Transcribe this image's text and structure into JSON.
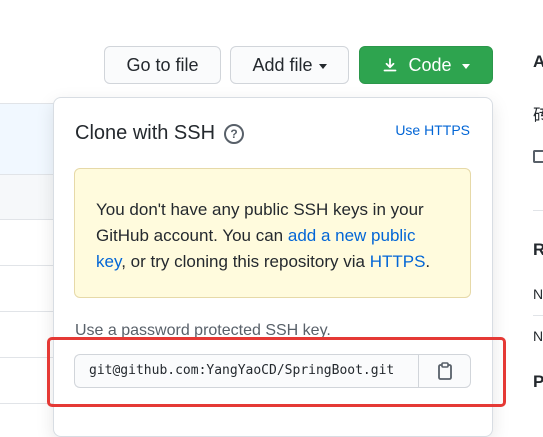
{
  "toolbar": {
    "go_to_file": "Go to file",
    "add_file": "Add file",
    "code": "Code"
  },
  "clone_panel": {
    "title": "Clone with SSH",
    "use_https": "Use HTTPS",
    "notice": {
      "text_1": "You don't have any public SSH keys in your GitHub account. You can ",
      "link_1": "add a new public key",
      "text_2": ", or try cloning this repository via ",
      "link_2": "HTTPS",
      "text_3": "."
    },
    "password_label": "Use a password protected SSH key.",
    "clone_url": "git@github.com:YangYaoCD/SpringBoot.git"
  },
  "sidebar_fragments": {
    "a": "A",
    "char": "砖",
    "r": "R",
    "n1": "N",
    "n2": "N",
    "p": "P"
  },
  "colors": {
    "code_button": "#2ea44f",
    "link": "#0366d6",
    "notice_bg": "#fffbdd",
    "highlight_box": "#e53935"
  }
}
